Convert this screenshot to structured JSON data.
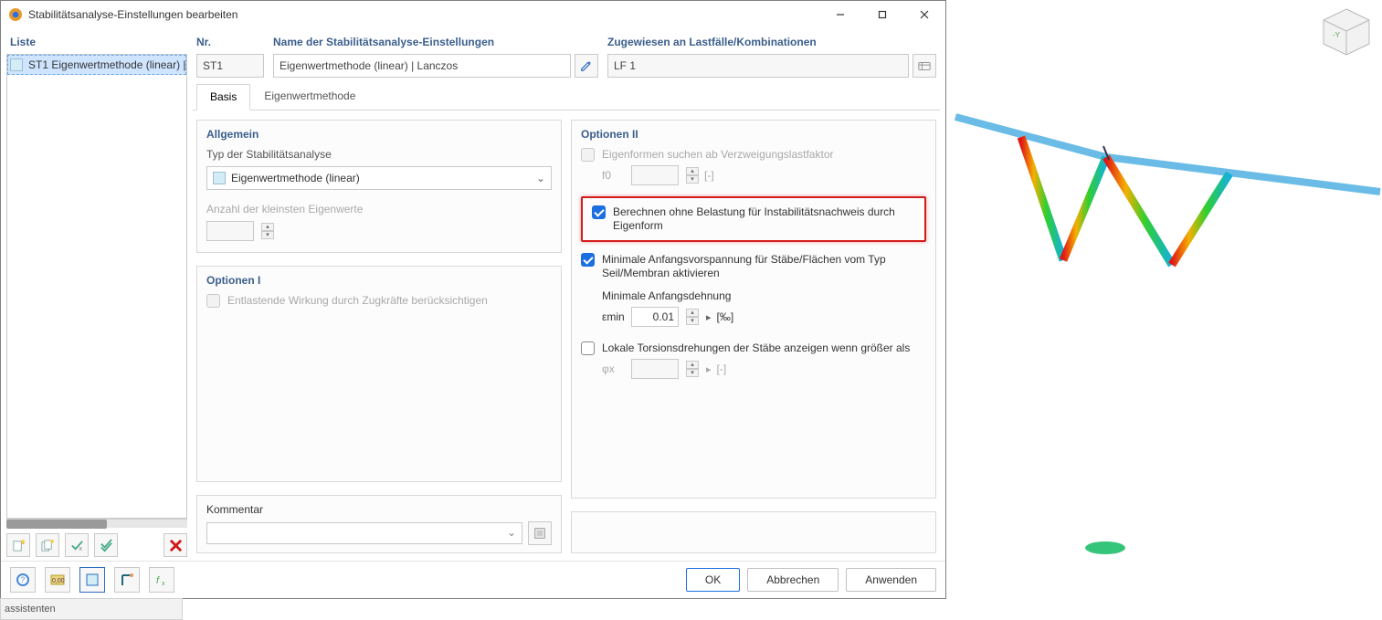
{
  "titlebar": {
    "title": "Stabilitätsanalyse-Einstellungen bearbeiten"
  },
  "list": {
    "header": "Liste",
    "items": [
      {
        "code": "ST1",
        "name": "Eigenwertmethode (linear) | Lancz"
      }
    ],
    "toolbar": {
      "new": "Neu",
      "copyset": "Kopieren",
      "chk1": "a",
      "chk2": "b",
      "delete": "Löschen"
    }
  },
  "header": {
    "nr": {
      "label": "Nr.",
      "value": "ST1"
    },
    "name": {
      "label": "Name der Stabilitätsanalyse-Einstellungen",
      "value": "Eigenwertmethode (linear) | Lanczos"
    },
    "assign": {
      "label": "Zugewiesen an Lastfälle/Kombinationen",
      "value": "LF 1"
    }
  },
  "tabs": {
    "basis": "Basis",
    "eigen": "Eigenwertmethode"
  },
  "left": {
    "allgemein": {
      "title": "Allgemein",
      "typ_label": "Typ der Stabilitätsanalyse",
      "typ_value": "Eigenwertmethode (linear)",
      "k_value_label": "Anzahl der kleinsten Eigenwerte"
    },
    "opt1": {
      "title": "Optionen I",
      "c1": "Entlastende Wirkung durch Zugkräfte berücksichtigen"
    }
  },
  "right": {
    "opt2": {
      "title": "Optionen II",
      "c1": "Eigenformen suchen ab Verzweigungslastfaktor",
      "f0": "f0",
      "f0unit": "[-]",
      "c2": "Berechnen ohne Belastung für Instabilitätsnachweis durch Eigenform",
      "c3": "Minimale Anfangsvorspannung für Stäbe/Flächen vom Typ Seil/Membran aktivieren",
      "c3sub": "Minimale Anfangsdehnung",
      "emin": "εmin",
      "eminval": "0.01",
      "eminunit": "[‰]",
      "c4": "Lokale Torsionsdrehungen der Stäbe anzeigen wenn größer als",
      "phi": "φx",
      "phiunit": "[-]"
    }
  },
  "comment": {
    "title": "Kommentar"
  },
  "actions": {
    "ok": "OK",
    "cancel": "Abbrechen",
    "apply": "Anwenden"
  },
  "peek": {
    "text": "assistenten"
  }
}
